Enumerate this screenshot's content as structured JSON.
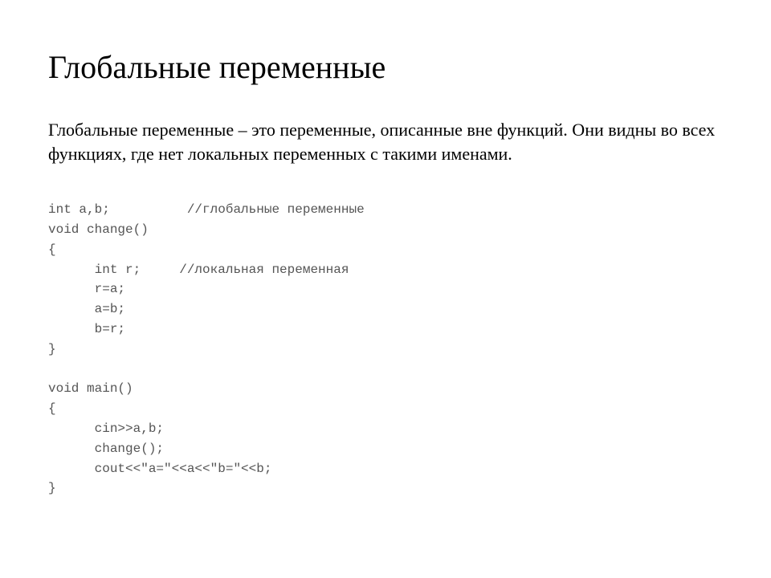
{
  "title": "Глобальные переменные",
  "description": "Глобальные переменные – это переменные, описанные вне функций. Они видны во всех функциях, где нет локальных переменных с такими именами.",
  "code": {
    "line1": "int a,b;          //глобальные переменные",
    "line2": "void change()",
    "line3": "{",
    "line4": "      int r;     //локальная переменная",
    "line5": "      r=a;",
    "line6": "      a=b;",
    "line7": "      b=r;",
    "line8": "}",
    "line9": "",
    "line10": "void main()",
    "line11": "{",
    "line12": "      cin>>a,b;",
    "line13": "      change();",
    "line14": "      cout<<\"a=\"<<a<<\"b=\"<<b;",
    "line15": "}"
  }
}
